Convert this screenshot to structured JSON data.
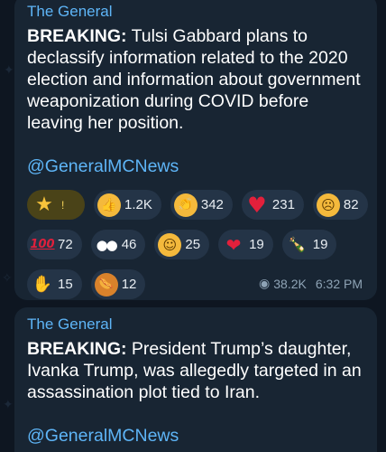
{
  "posts": [
    {
      "channel": "The General",
      "lead": "BREAKING:",
      "body": " Tulsi Gabbard plans to declassify information related to the 2020 election and information about government weaponization during COVID before leaving her position.",
      "link": "@GeneralMCNews",
      "reactions": [
        {
          "icon": "star-icon",
          "count": ""
        },
        {
          "icon": "thumbs-up-icon",
          "count": "1.2K"
        },
        {
          "icon": "clapping-hands-icon",
          "count": "342"
        },
        {
          "icon": "red-heart-icon",
          "count": "231"
        },
        {
          "icon": "yawning-face-icon",
          "count": "82"
        },
        {
          "icon": "hundred-points-icon",
          "count": "72"
        },
        {
          "icon": "eyes-icon",
          "count": "46"
        },
        {
          "icon": "thinking-face-icon",
          "count": "25"
        },
        {
          "icon": "heart-on-fire-icon",
          "count": "19"
        },
        {
          "icon": "champagne-bottle-icon",
          "count": "19"
        },
        {
          "icon": "middle-finger-icon",
          "count": "15"
        },
        {
          "icon": "hot-dog-icon",
          "count": "12"
        }
      ],
      "views": "38.2K",
      "time": "6:32 PM"
    },
    {
      "channel": "The General",
      "lead": "BREAKING:",
      "body": " President Trump’s daughter, Ivanka Trump, was allegedly targeted in an assassination plot tied to Iran.",
      "link": "@GeneralMCNews"
    }
  ],
  "colors": {
    "background": "#0e1621",
    "bubble": "#182533",
    "accent": "#5eb5f7",
    "meta": "#8ea3b5",
    "chip": "#243447",
    "star_chip": "#4a4318"
  }
}
